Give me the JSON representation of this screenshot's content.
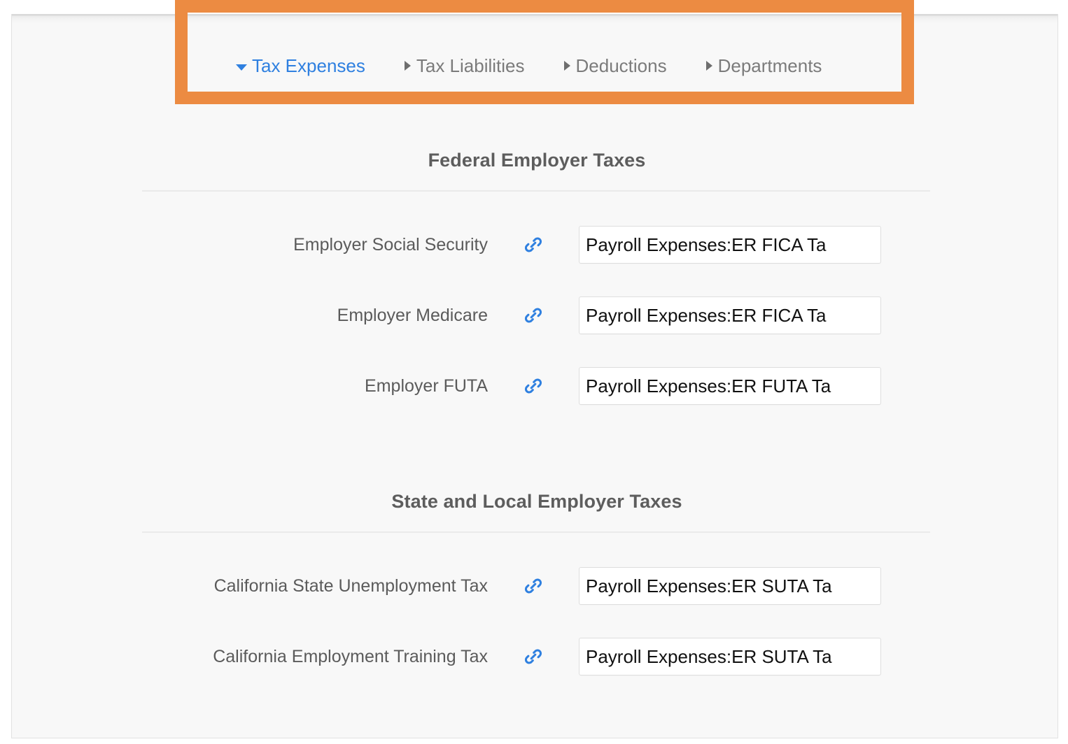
{
  "highlight": {
    "color": "#ec8b42"
  },
  "tabs": [
    {
      "label": "Tax Expenses",
      "state": "expanded",
      "marker": "triangle-down-icon"
    },
    {
      "label": "Tax Liabilities",
      "state": "collapsed",
      "marker": "triangle-right-icon"
    },
    {
      "label": "Deductions",
      "state": "collapsed",
      "marker": "triangle-right-icon"
    },
    {
      "label": "Departments",
      "state": "collapsed",
      "marker": "triangle-right-icon"
    }
  ],
  "sections": [
    {
      "title": "Federal Employer Taxes",
      "rows": [
        {
          "label": "Employer Social Security",
          "icon": "link-icon",
          "value": "Payroll Expenses:ER FICA Ta"
        },
        {
          "label": "Employer Medicare",
          "icon": "link-icon",
          "value": "Payroll Expenses:ER FICA Ta"
        },
        {
          "label": "Employer FUTA",
          "icon": "link-icon",
          "value": "Payroll Expenses:ER FUTA Ta"
        }
      ]
    },
    {
      "title": "State and Local Employer Taxes",
      "rows": [
        {
          "label": "California State Unemployment Tax",
          "icon": "link-icon",
          "value": "Payroll Expenses:ER SUTA Ta"
        },
        {
          "label": "California Employment Training Tax",
          "icon": "link-icon",
          "value": "Payroll Expenses:ER SUTA Ta"
        }
      ]
    }
  ],
  "colors": {
    "active_tab": "#2f80e0",
    "inactive_tab": "#7b7b7b",
    "link_icon": "#2f80e0",
    "heading": "#5d5d5d",
    "label": "#5b5b5b",
    "panel_bg": "#f8f8f8"
  }
}
